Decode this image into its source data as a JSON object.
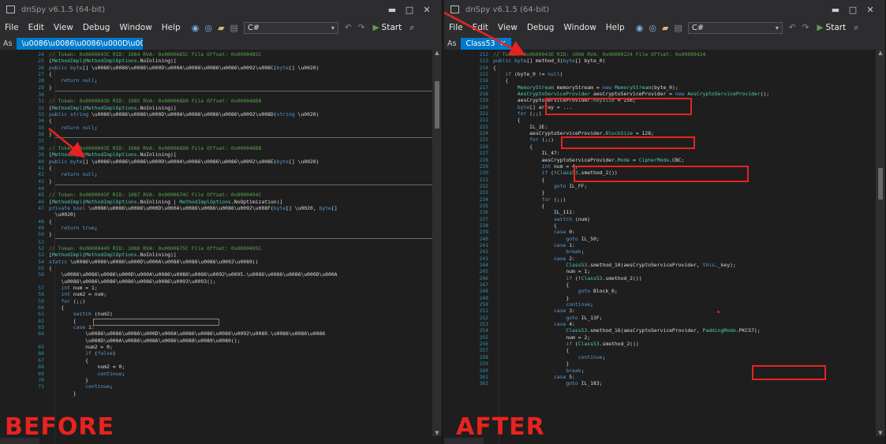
{
  "left": {
    "title": "dnSpy v6.1.5 (64-bit)",
    "menu": [
      "File",
      "Edit",
      "View",
      "Debug",
      "Window",
      "Help"
    ],
    "language": "C#",
    "start_label": "Start",
    "tab_prefix": "As",
    "tab_label": "\\u0086\\u0086\\u0086\\u000D\\u000A\\u00...",
    "code": [
      {
        "n": "24",
        "h": "<span class='cm'>// Token: 0x0600043C RID: 1084 RVA: 0x0000665C File Offset: 0x0000485C</span>"
      },
      {
        "n": "25",
        "h": "[<span class='ty'>MethodImpl</span>(<span class='ty'>MethodImplOptions</span>.NoInlining)]"
      },
      {
        "n": "26",
        "h": "<span class='kw'>public</span> <span class='kw'>byte</span>[] \\u0086\\u0086\\u0086\\u000D\\u000A\\u0086\\u0086\\u0086\\u0092\\u008C(<span class='kw'>byte</span>[] \\u0020)"
      },
      {
        "n": "27",
        "h": "{"
      },
      {
        "n": "28",
        "h": "    <span class='kw'>return</span> <span class='kw'>null</span>;"
      },
      {
        "n": "29",
        "h": "}"
      },
      {
        "n": "30",
        "h": "",
        "sep": true
      },
      {
        "n": "31",
        "h": "<span class='cm'>// Token: 0x0600043D RID: 1085 RVA: 0x000066D0 File Offset: 0x000048D0</span>"
      },
      {
        "n": "32",
        "h": "[<span class='ty'>MethodImpl</span>(<span class='ty'>MethodImplOptions</span>.NoInlining)]"
      },
      {
        "n": "33",
        "h": "<span class='kw'>public</span> <span class='kw'>string</span> \\u0086\\u0086\\u0086\\u000D\\u000A\\u0086\\u0086\\u0086\\u0092\\u008D(<span class='kw'>string</span> \\u0020)"
      },
      {
        "n": "34",
        "h": "{"
      },
      {
        "n": "35",
        "h": "    <span class='kw'>return</span> <span class='kw'>null</span>;"
      },
      {
        "n": "36",
        "h": "}"
      },
      {
        "n": "37",
        "h": "",
        "sep": true
      },
      {
        "n": "38",
        "h": "<span class='cm'>// Token: 0x0600043E RID: 1086 RVA: 0x000066D8 File Offset: 0x000048D8</span>"
      },
      {
        "n": "39",
        "h": "[<span class='ty'>MethodImpl</span>(<span class='ty'>MethodImplOptions</span>.NoInlining)]"
      },
      {
        "n": "40",
        "h": "<span class='kw'>public</span> <span class='kw'>byte</span>[] \\u0086\\u0086\\u0086\\u000D\\u000A\\u0086\\u0086\\u0086\\u0092\\u008E(<span class='kw'>byte</span>[] \\u0020)"
      },
      {
        "n": "41",
        "h": "{"
      },
      {
        "n": "42",
        "h": "    <span class='kw'>return</span> <span class='kw'>null</span>;"
      },
      {
        "n": "43",
        "h": "}"
      },
      {
        "n": "44",
        "h": "",
        "sep": true
      },
      {
        "n": "45",
        "h": "<span class='cm'>// Token: 0x0600043F RID: 1087 RVA: 0x0000674C File Offset: 0x0000494C</span>"
      },
      {
        "n": "46",
        "h": "[<span class='ty'>MethodImpl</span>(<span class='ty'>MethodImplOptions</span>.NoInlining | <span class='ty'>MethodImplOptions</span>.NoOptimization)]"
      },
      {
        "n": "47",
        "h": "<span class='kw'>private</span> <span class='kw'>bool</span> \\u0086\\u0086\\u0086\\u000D\\u000A\\u0086\\u0086\\u0086\\u0092\\u008F(<span class='kw'>byte</span>[] \\u0020, <span class='kw'>byte</span>[]"
      },
      {
        "n": "",
        "h": "  \\u0020)"
      },
      {
        "n": "48",
        "h": "{"
      },
      {
        "n": "49",
        "h": "    <span class='kw'>return</span> <span class='kw'>true</span>;"
      },
      {
        "n": "50",
        "h": "}"
      },
      {
        "n": "51",
        "h": "",
        "sep": true
      },
      {
        "n": "52",
        "h": "<span class='cm'>// Token: 0x06000440 RID: 1088 RVA: 0x0000675C File Offset: 0x0000495C</span>"
      },
      {
        "n": "53",
        "h": "[<span class='ty'>MethodImpl</span>(<span class='ty'>MethodImplOptions</span>.NoInlining)]"
      },
      {
        "n": "54",
        "h": "<span class='kw'>static</span> \\u0086\\u0086\\u0086\\u000D\\u000A\\u0086\\u0086\\u0086\\u0092\\u0089()"
      },
      {
        "n": "55",
        "h": "{"
      },
      {
        "n": "56",
        "h": "    \\u0086\\u0086\\u0086\\u000D\\u000A\\u0086\\u0086\\u0086\\u0092\\u0095.\\u0086\\u0086\\u0086\\u000D\\u000A"
      },
      {
        "n": "",
        "h": "    \\u0086\\u0086\\u0086\\u0086\\u0086\\u0086\\u0093\\u0093();"
      },
      {
        "n": "57",
        "h": "    <span class='kw'>int</span> num = 1;"
      },
      {
        "n": "58",
        "h": "    <span class='kw'>int</span> num2 = num;",
        "box": true
      },
      {
        "n": "59",
        "h": "    <span class='kw'>for</span> (;;)"
      },
      {
        "n": "60",
        "h": "    {"
      },
      {
        "n": "61",
        "h": "        <span class='kw'>switch</span> (num2)"
      },
      {
        "n": "62",
        "h": "        {"
      },
      {
        "n": "63",
        "h": "        <span class='kw'>case</span> 1:"
      },
      {
        "n": "64",
        "h": "            \\u0086\\u0086\\u0086\\u000D\\u000A\\u0086\\u0086\\u0086\\u0092\\u0089.\\u0086\\u0086\\u0086"
      },
      {
        "n": "",
        "h": "            \\u000D\\u000A\\u0086\\u0086\\u0086\\u0088\\u0089\\u0080();"
      },
      {
        "n": "65",
        "h": "            num2 = 0;"
      },
      {
        "n": "66",
        "h": "            <span class='kw'>if</span> (<span class='kw'>false</span>)"
      },
      {
        "n": "67",
        "h": "            {"
      },
      {
        "n": "68",
        "h": "                num2 = 0;"
      },
      {
        "n": "69",
        "h": "                <span class='kw'>continue</span>;"
      },
      {
        "n": "70",
        "h": "            }"
      },
      {
        "n": "71",
        "h": "            <span class='kw'>continue</span>;"
      },
      {
        "n": "",
        "h": "        }"
      }
    ]
  },
  "right": {
    "title": "dnSpy v6.1.5 (64-bit)",
    "menu": [
      "File",
      "Edit",
      "View",
      "Debug",
      "Window",
      "Help"
    ],
    "language": "C#",
    "start_label": "Start",
    "tab_prefix": "As",
    "tab_label": "Class53",
    "code": [
      {
        "n": "212",
        "h": "<span class='cm'>// Token: 0x0600043E RID: 1006 RVA: 0x00000224 File Offset: 0x00009424</span>"
      },
      {
        "n": "213",
        "h": "<span class='kw'>public</span> <span class='kw'>byte</span>[] method_3(<span class='kw'>byte</span>[] byte_0)"
      },
      {
        "n": "214",
        "h": "{"
      },
      {
        "n": "215",
        "h": "    <span class='kw'>if</span> (byte_0 != <span class='kw'>null</span>)"
      },
      {
        "n": "216",
        "h": "    {"
      },
      {
        "n": "217",
        "h": "        <span class='ty'>MemoryStream</span> memoryStream = <span class='kw'>new</span> <span class='ty'>MemoryStream</span>(byte_0);"
      },
      {
        "n": "218",
        "h": "        <span class='ty'>AesCryptoServiceProvider</span> aesCryptoServiceProvider = <span class='kw'>new</span> <span class='ty'>AesCryptoServiceProvider</span>();"
      },
      {
        "n": "219",
        "h": "        aesCryptoServiceProvider.<span class='ty'>KeySize</span> = 256;"
      },
      {
        "n": "220",
        "h": "        <span class='kw'>byte</span>[] array = ..."
      },
      {
        "n": "221",
        "h": "        <span class='kw'>for</span> (;;)"
      },
      {
        "n": "222",
        "h": "        {"
      },
      {
        "n": "223",
        "h": "            IL_2E:"
      },
      {
        "n": "224",
        "h": "            aesCryptoServiceProvider.<span class='ty'>BlockSize</span> = 128;"
      },
      {
        "n": "225",
        "h": "            <span class='kw'>for</span> (;;)"
      },
      {
        "n": "226",
        "h": "            {"
      },
      {
        "n": "227",
        "h": "                IL_47:"
      },
      {
        "n": "228",
        "h": "                aesCryptoServiceProvider.<span class='ty'>Mode</span> = <span class='ty'>CipherMode</span>.CBC;"
      },
      {
        "n": "229",
        "h": "                <span class='kw'>int</span> num = 4;"
      },
      {
        "n": "230",
        "h": "                <span class='kw'>if</span> (!<span class='ty'>Class53</span>.smethod_2())"
      },
      {
        "n": "231",
        "h": "                {"
      },
      {
        "n": "232",
        "h": "                    <span class='kw'>goto</span> IL_FF;"
      },
      {
        "n": "233",
        "h": "                }"
      },
      {
        "n": "234",
        "h": "                <span class='kw'>for</span> (;;)"
      },
      {
        "n": "235",
        "h": "                {"
      },
      {
        "n": "236",
        "h": "                    IL_111:"
      },
      {
        "n": "237",
        "h": "                    <span class='kw'>switch</span> (num)"
      },
      {
        "n": "238",
        "h": "                    {"
      },
      {
        "n": "239",
        "h": "                    <span class='kw'>case</span> 0:"
      },
      {
        "n": "240",
        "h": "                        <span class='kw'>goto</span> IL_50;"
      },
      {
        "n": "241",
        "h": "                    <span class='kw'>case</span> 1:"
      },
      {
        "n": "242",
        "h": "                        <span class='kw'>break</span>;"
      },
      {
        "n": "243",
        "h": "                    <span class='kw'>case</span> 2:"
      },
      {
        "n": "244",
        "h": "                        <span class='ty'>Class53</span>.smethod_10(aesCryptoServiceProvider, <span class='kw'>this</span>._key);"
      },
      {
        "n": "245",
        "h": "                        num = 1;"
      },
      {
        "n": "246",
        "h": "                        <span class='kw'>if</span> (!<span class='ty'>Class53</span>.smethod_2())"
      },
      {
        "n": "247",
        "h": "                        {"
      },
      {
        "n": "248",
        "h": "                            <span class='kw'>goto</span> Block_6;"
      },
      {
        "n": "249",
        "h": "                        }"
      },
      {
        "n": "250",
        "h": "                        <span class='kw'>continue</span>;"
      },
      {
        "n": "251",
        "h": "                    <span class='kw'>case</span> 3:"
      },
      {
        "n": "252",
        "h": "                        <span class='kw'>goto</span> IL_13F;"
      },
      {
        "n": "253",
        "h": "                    <span class='kw'>case</span> 4:"
      },
      {
        "n": "254",
        "h": "                        <span class='ty'>Class53</span>.smethod_16(aesCryptoServiceProvider, <span class='ty'>PaddingMode</span>.PKCS7);"
      },
      {
        "n": "255",
        "h": "                        num = 2;"
      },
      {
        "n": "256",
        "h": "                        <span class='kw'>if</span> (<span class='ty'>Class53</span>.smethod_2())"
      },
      {
        "n": "257",
        "h": "                        {"
      },
      {
        "n": "258",
        "h": "                            <span class='kw'>continue</span>;"
      },
      {
        "n": "259",
        "h": "                        }"
      },
      {
        "n": "260",
        "h": "                        <span class='kw'>break</span>;"
      },
      {
        "n": "261",
        "h": "                    <span class='kw'>case</span> 5:"
      },
      {
        "n": "262",
        "h": "                        <span class='kw'>goto</span> IL_183;"
      }
    ]
  },
  "labels": {
    "before": "BEFORE",
    "after": "AFTER"
  },
  "colors": {
    "annotation": "#e8231f",
    "accent": "#007acc",
    "background": "#1e1e1e"
  }
}
